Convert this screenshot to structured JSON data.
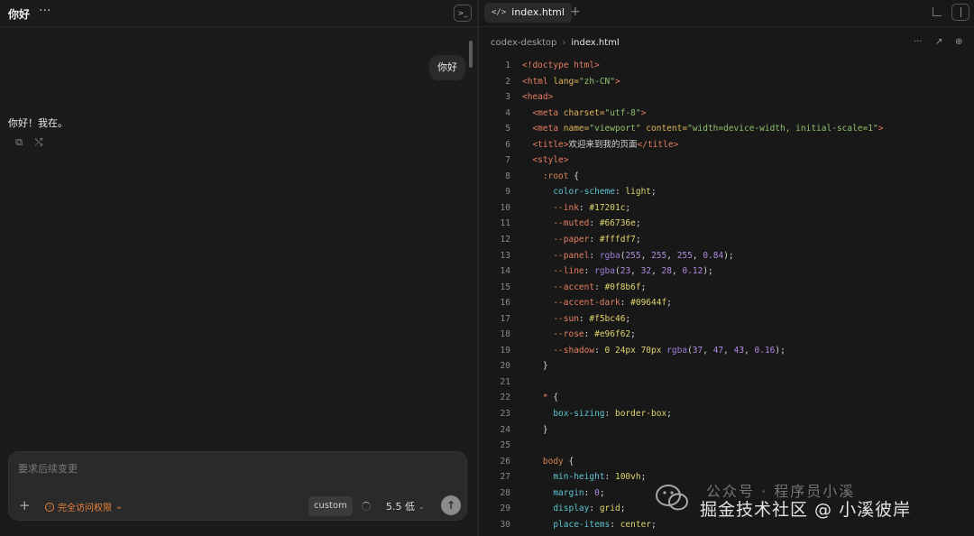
{
  "chat": {
    "title": "你好",
    "more_label": "···",
    "terminal_icon": "terminal-icon",
    "user_message": "你好",
    "assistant_message": "你好！我在。",
    "actions": {
      "copy_icon": "copy-icon",
      "branch_icon": "branch-icon"
    }
  },
  "composer": {
    "placeholder": "要求后续变更",
    "plus": "+",
    "permission_label": "完全访问权限",
    "permission_icon": "!",
    "mode_label": "custom",
    "model_label": "5.5 低",
    "chevron": "⌄",
    "send": "↑"
  },
  "editor": {
    "tab_icon": "</>",
    "tab_label": "index.html",
    "add_tab": "+",
    "breadcrumb": {
      "folder": "codex-desktop",
      "separator": "›",
      "file": "index.html"
    },
    "toolbar": {
      "more": "···",
      "open_external": "↗",
      "new_window": "⊕"
    },
    "lines": [
      {
        "n": "1"
      },
      {
        "n": "2"
      },
      {
        "n": "3"
      },
      {
        "n": "4"
      },
      {
        "n": "5"
      },
      {
        "n": "6"
      },
      {
        "n": "7"
      },
      {
        "n": "8"
      },
      {
        "n": "9"
      },
      {
        "n": "10"
      },
      {
        "n": "11"
      },
      {
        "n": "12"
      },
      {
        "n": "13"
      },
      {
        "n": "14"
      },
      {
        "n": "15"
      },
      {
        "n": "16"
      },
      {
        "n": "17"
      },
      {
        "n": "18"
      },
      {
        "n": "19"
      },
      {
        "n": "20"
      },
      {
        "n": "21"
      },
      {
        "n": "22"
      },
      {
        "n": "23"
      },
      {
        "n": "24"
      },
      {
        "n": "25"
      },
      {
        "n": "26"
      },
      {
        "n": "27"
      },
      {
        "n": "28"
      },
      {
        "n": "29"
      },
      {
        "n": "30"
      }
    ],
    "code": {
      "l1": [
        "<!doctype html>"
      ],
      "l2": [
        "<html ",
        "lang=",
        "\"zh-CN\"",
        ">"
      ],
      "l3": [
        "<head>"
      ],
      "l4": [
        "  <meta ",
        "charset=",
        "\"utf-8\"",
        ">"
      ],
      "l5": [
        "  <meta ",
        "name=",
        "\"viewport\"",
        " content=",
        "\"width=device-width, initial-scale=1\"",
        ">"
      ],
      "l6": [
        "  <title>",
        "欢迎来到我的页面",
        "</title>"
      ],
      "l7": [
        "  <style>"
      ],
      "l8": [
        "    :root",
        " {"
      ],
      "l9": [
        "      color-scheme",
        ": ",
        "light",
        ";"
      ],
      "l10": [
        "      --ink",
        ": ",
        "#17201c",
        ";"
      ],
      "l11": [
        "      --muted",
        ": ",
        "#66736e",
        ";"
      ],
      "l12": [
        "      --paper",
        ": ",
        "#fffdf7",
        ";"
      ],
      "l13": [
        "      --panel",
        ": ",
        "rgba",
        "(",
        "255",
        ", ",
        "255",
        ", ",
        "255",
        ", ",
        "0.84",
        ");"
      ],
      "l14": [
        "      --line",
        ": ",
        "rgba",
        "(",
        "23",
        ", ",
        "32",
        ", ",
        "28",
        ", ",
        "0.12",
        ");"
      ],
      "l15": [
        "      --accent",
        ": ",
        "#0f8b6f",
        ";"
      ],
      "l16": [
        "      --accent-dark",
        ": ",
        "#09644f",
        ";"
      ],
      "l17": [
        "      --sun",
        ": ",
        "#f5bc46",
        ";"
      ],
      "l18": [
        "      --rose",
        ": ",
        "#e96f62",
        ";"
      ],
      "l19": [
        "      --shadow",
        ": ",
        "0 24px 70px ",
        "rgba",
        "(",
        "37",
        ", ",
        "47",
        ", ",
        "43",
        ", ",
        "0.16",
        ");"
      ],
      "l20": [
        "    }"
      ],
      "l21": [
        ""
      ],
      "l22": [
        "    ",
        "*",
        " {"
      ],
      "l23": [
        "      box-sizing",
        ": ",
        "border-box",
        ";"
      ],
      "l24": [
        "    }"
      ],
      "l25": [
        ""
      ],
      "l26": [
        "    body",
        " {"
      ],
      "l27": [
        "      min-height",
        ": ",
        "100vh",
        ";"
      ],
      "l28": [
        "      margin",
        ": ",
        "0",
        ";"
      ],
      "l29": [
        "      display",
        ": ",
        "grid",
        ";"
      ],
      "l30": [
        "      place-items",
        ": ",
        "center",
        ";"
      ]
    }
  },
  "watermark": {
    "line1": "公众号 · 程序员小溪",
    "line2": "掘金技术社区 @ 小溪彼岸",
    "logo_icon": "wechat-logo-icon"
  }
}
